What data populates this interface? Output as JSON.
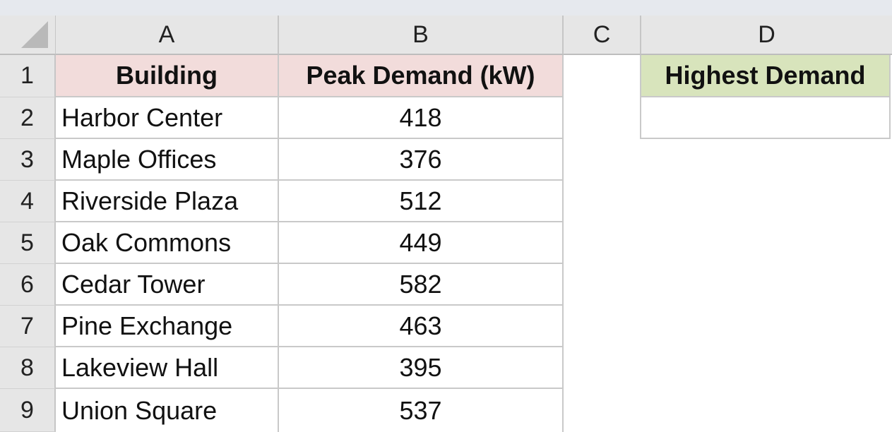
{
  "columns": [
    "A",
    "B",
    "C",
    "D"
  ],
  "rows": [
    "1",
    "2",
    "3",
    "4",
    "5",
    "6",
    "7",
    "8",
    "9"
  ],
  "headers": {
    "building": "Building",
    "peak_demand": "Peak Demand (kW)",
    "highest_demand": "Highest Demand"
  },
  "data": [
    {
      "building": "Harbor Center",
      "peak": "418"
    },
    {
      "building": "Maple Offices",
      "peak": "376"
    },
    {
      "building": "Riverside Plaza",
      "peak": "512"
    },
    {
      "building": "Oak Commons",
      "peak": "449"
    },
    {
      "building": "Cedar Tower",
      "peak": "582"
    },
    {
      "building": "Pine Exchange",
      "peak": "463"
    },
    {
      "building": "Lakeview Hall",
      "peak": "395"
    },
    {
      "building": "Union Square",
      "peak": "537"
    }
  ],
  "highest_demand_value": "",
  "colors": {
    "header_pink": "#f2dcdb",
    "header_green": "#d8e4bc",
    "heading_gray": "#e6e6e6"
  }
}
